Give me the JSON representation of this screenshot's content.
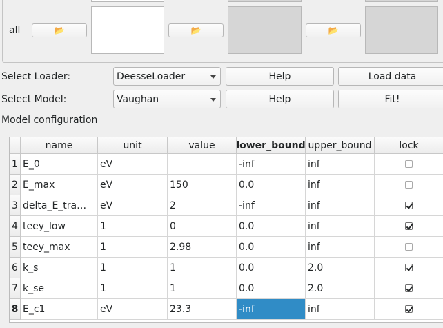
{
  "loader_row": {
    "label": "all",
    "folder_icon": "folder-open-icon"
  },
  "select_loader": {
    "label": "Select Loader:",
    "value": "DeesseLoader",
    "help_label": "Help",
    "action_label": "Load data"
  },
  "select_model": {
    "label": "Select Model:",
    "value": "Vaughan",
    "help_label": "Help",
    "action_label": "Fit!"
  },
  "model_config": {
    "title": "Model configuration",
    "columns": [
      "name",
      "unit",
      "value",
      "lower_bound",
      "upper_bound",
      "lock"
    ],
    "rows": [
      {
        "num": "1",
        "name": "E_0",
        "unit": "eV",
        "value": "",
        "lower": "-inf",
        "upper": "inf",
        "lock": false
      },
      {
        "num": "2",
        "name": "E_max",
        "unit": "eV",
        "value": "150",
        "lower": "0.0",
        "upper": "inf",
        "lock": false
      },
      {
        "num": "3",
        "name": "delta_E_tra…",
        "unit": "eV",
        "value": "2",
        "lower": "-inf",
        "upper": "inf",
        "lock": true
      },
      {
        "num": "4",
        "name": "teey_low",
        "unit": "1",
        "value": "0",
        "lower": "0.0",
        "upper": "inf",
        "lock": true
      },
      {
        "num": "5",
        "name": "teey_max",
        "unit": "1",
        "value": "2.98",
        "lower": "0.0",
        "upper": "inf",
        "lock": false
      },
      {
        "num": "6",
        "name": "k_s",
        "unit": "1",
        "value": "1",
        "lower": "0.0",
        "upper": "2.0",
        "lock": true
      },
      {
        "num": "7",
        "name": "k_se",
        "unit": "1",
        "value": "1",
        "lower": "0.0",
        "upper": "2.0",
        "lock": true
      },
      {
        "num": "8",
        "name": "E_c1",
        "unit": "eV",
        "value": "23.3",
        "lower": "-inf",
        "upper": "inf",
        "lock": true
      }
    ],
    "selected_row": 8,
    "selected_column": "lower_bound"
  },
  "colors": {
    "selection": "#308cc6",
    "window_bg": "#efefef"
  }
}
